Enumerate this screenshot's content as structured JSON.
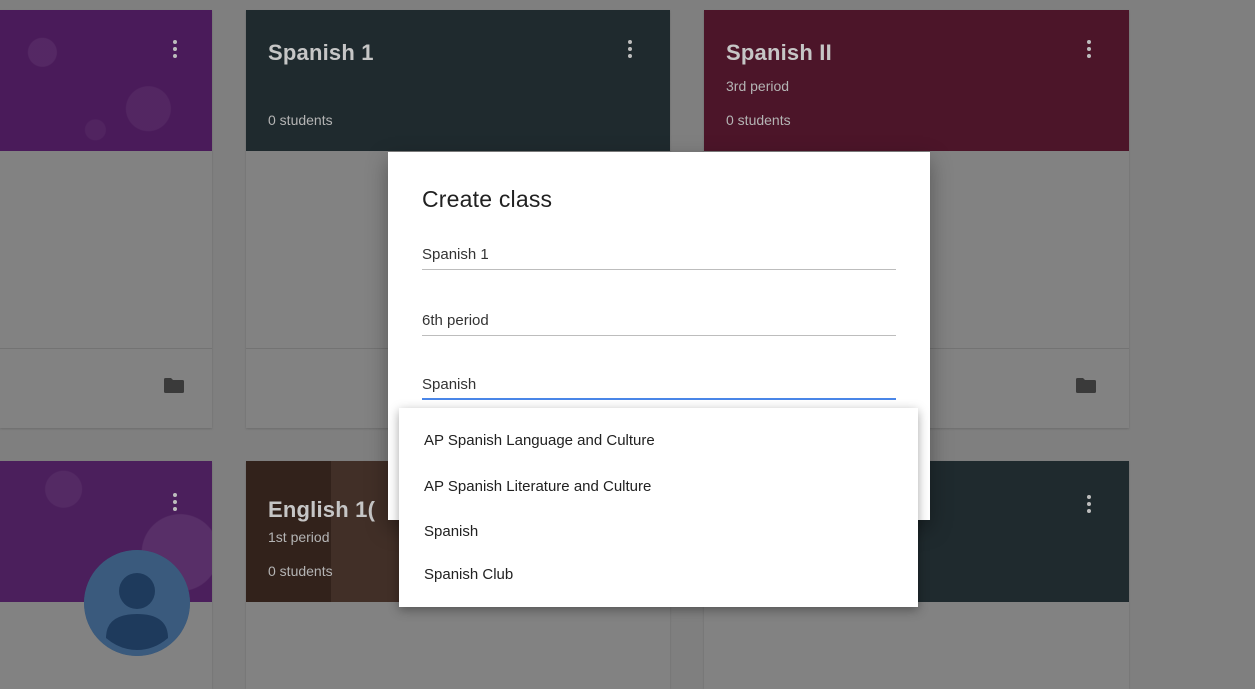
{
  "cards": [
    {
      "title": "",
      "section": "",
      "students": ""
    },
    {
      "title": "Spanish 1",
      "section": "",
      "students": "0 students"
    },
    {
      "title": "Spanish II",
      "section": "3rd period",
      "students": "0 students"
    },
    {
      "title": "",
      "section": "",
      "students": ""
    },
    {
      "title": "English 1(",
      "section": "1st period",
      "students": "0 students"
    },
    {
      "title": "",
      "section": "",
      "students": ""
    }
  ],
  "dialog": {
    "title": "Create class",
    "name_value": "Spanish 1",
    "section_value": "6th period",
    "subject_value": "Spanish"
  },
  "dropdown": {
    "options": [
      "AP Spanish Language and Culture",
      "AP Spanish Literature and Culture",
      "Spanish",
      "Spanish Club"
    ]
  },
  "colors": {
    "overlay_background": "#7f7f7f",
    "card_purple": "#4a1b5a",
    "card_dark_teal": "#1f2a2e",
    "card_maroon": "#4c1529",
    "card_brown": "#3b2820",
    "accent_blue": "#4a86e8"
  },
  "icons": {
    "card_menu": "more-vert-icon",
    "card_folder": "folder-icon",
    "user_avatar": "account-circle-icon"
  }
}
